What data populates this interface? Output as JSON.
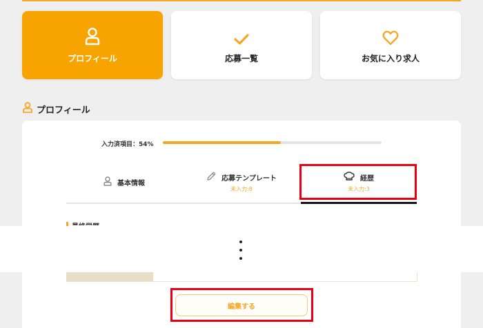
{
  "nav": {
    "cards": [
      {
        "label": "プロフィール",
        "icon": "user-icon",
        "active": true
      },
      {
        "label": "応募一覧",
        "icon": "check-icon",
        "active": false
      },
      {
        "label": "お気に入り求人",
        "icon": "heart-icon",
        "active": false
      }
    ]
  },
  "section": {
    "title": "プロフィール",
    "icon": "user-icon"
  },
  "progress": {
    "label": "入力済項目：54%",
    "percent": 54
  },
  "tabs": [
    {
      "label": "基本情報",
      "sub": "",
      "icon": "user-icon"
    },
    {
      "label": "応募テンプレート",
      "sub": "未入力:8",
      "icon": "pencil-icon"
    },
    {
      "label": "経歴",
      "sub": "未入力:3",
      "icon": "chef-hat-icon",
      "active": true
    }
  ],
  "career": {
    "heading": "最終学歴"
  },
  "edit_button": {
    "label": "編集する"
  },
  "colors": {
    "accent": "#f5a623",
    "highlight": "#e60012"
  }
}
